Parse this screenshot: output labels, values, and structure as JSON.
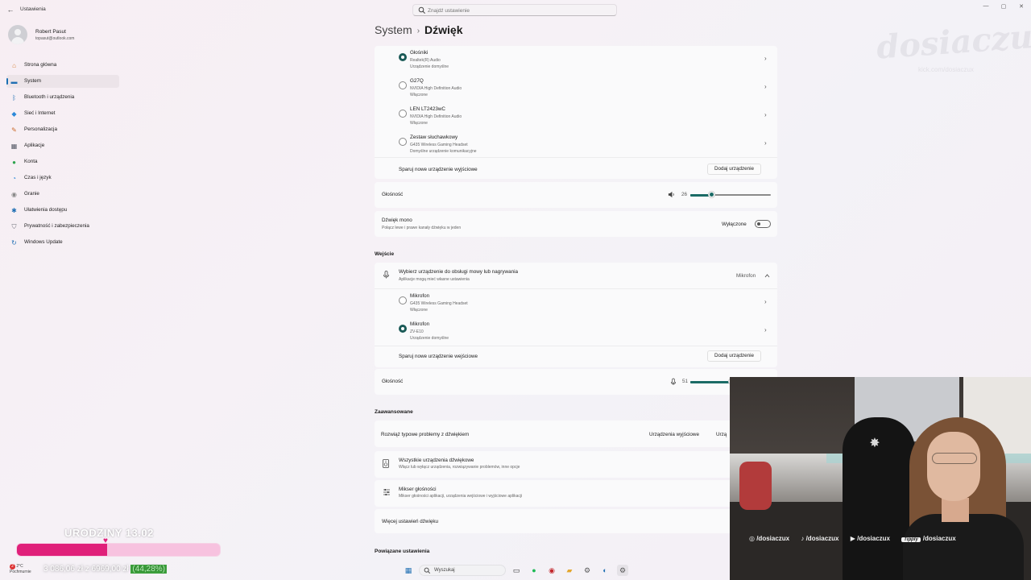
{
  "window": {
    "title": "Ustawienia",
    "back_glyph": "←",
    "controls": {
      "minimize": "—",
      "maximize": "▢",
      "close": "✕"
    }
  },
  "search": {
    "placeholder": "Znajdź ustawienie"
  },
  "profile": {
    "name": "Robert Pasut",
    "email": "topasut@outlook.com"
  },
  "nav": [
    {
      "label": "Strona główna",
      "icon": "home-icon",
      "glyph": "⌂",
      "color": "#d9823b"
    },
    {
      "label": "System",
      "icon": "display-icon",
      "glyph": "▬",
      "color": "#1f6fb3",
      "active": true
    },
    {
      "label": "Bluetooth i urządzenia",
      "icon": "bluetooth-icon",
      "glyph": "ᛒ",
      "color": "#1f6fb3"
    },
    {
      "label": "Sieć i Internet",
      "icon": "wifi-icon",
      "glyph": "◆",
      "color": "#2b88d8"
    },
    {
      "label": "Personalizacja",
      "icon": "brush-icon",
      "glyph": "✎",
      "color": "#cc6a2a"
    },
    {
      "label": "Aplikacje",
      "icon": "apps-icon",
      "glyph": "▦",
      "color": "#555a66"
    },
    {
      "label": "Konta",
      "icon": "person-icon",
      "glyph": "●",
      "color": "#2ea34e"
    },
    {
      "label": "Czas i język",
      "icon": "globe-clock-icon",
      "glyph": "◔",
      "color": "#2b88d8"
    },
    {
      "label": "Granie",
      "icon": "gamepad-icon",
      "glyph": "◉",
      "color": "#888"
    },
    {
      "label": "Ułatwienia dostępu",
      "icon": "accessibility-icon",
      "glyph": "✱",
      "color": "#1f6fb3"
    },
    {
      "label": "Prywatność i zabezpieczenia",
      "icon": "shield-icon",
      "glyph": "⛉",
      "color": "#6c6f78"
    },
    {
      "label": "Windows Update",
      "icon": "update-icon",
      "glyph": "↻",
      "color": "#1f6fb3"
    }
  ],
  "breadcrumb": {
    "parent": "System",
    "separator": "›",
    "current": "Dźwięk"
  },
  "output_devices": [
    {
      "name": "Głośniki",
      "driver": "Realtek(R) Audio",
      "status": "Urządzenie domyślne",
      "selected": true
    },
    {
      "name": "G27Q",
      "driver": "NVIDIA High Definition Audio",
      "status": "Włączone",
      "selected": false
    },
    {
      "name": "LEN LT2423wC",
      "driver": "NVIDIA High Definition Audio",
      "status": "Włączone",
      "selected": false
    },
    {
      "name": "Zestaw słuchawkowy",
      "driver": "G435 Wireless Gaming Headset",
      "status": "Domyślne urządzenie komunikacyjne",
      "selected": false
    }
  ],
  "output_pair": {
    "label": "Sparuj nowe urządzenie wyjściowe",
    "button": "Dodaj urządzenie"
  },
  "output_volume": {
    "label": "Głośność",
    "value": "26",
    "level": 0.26
  },
  "mono": {
    "title": "Dźwięk mono",
    "subtitle": "Połącz lewe i prawe kanały dźwięku w jeden",
    "state": "Wyłączone"
  },
  "input": {
    "heading": "Wejście",
    "choose_title": "Wybierz urządzenie do obsługi mowy lub nagrywania",
    "choose_sub": "Aplikacje mogą mieć własne ustawienia",
    "selected_label": "Mikrofon",
    "devices": [
      {
        "name": "Mikrofon",
        "driver": "G435 Wireless Gaming Headset",
        "status": "Włączone",
        "selected": false
      },
      {
        "name": "Mikrofon",
        "driver": "ZV-E10",
        "status": "Urządzenie domyślne",
        "selected": true
      }
    ],
    "pair_label": "Sparuj nowe urządzenie wejściowe",
    "pair_button": "Dodaj urządzenie",
    "volume_label": "Głośność",
    "volume_value": "51",
    "volume_level": 0.51
  },
  "advanced": {
    "heading": "Zaawansowane",
    "troubleshoot": "Rozwiąż typowe problemy z dźwiękiem",
    "troubleshoot_btn1": "Urządzenia wyjściowe",
    "troubleshoot_btn2": "Urzą",
    "all_devices_title": "Wszystkie urządzenia dźwiękowe",
    "all_devices_sub": "Włącz lub wyłącz urządzenia, rozwiązywanie problemów, inne opcje",
    "mixer_title": "Mikser głośności",
    "mixer_sub": "Mikser głośności aplikacji, urządzenia wejściowe i wyjściowe aplikacji",
    "more": "Więcej ustawień dźwięku"
  },
  "related": {
    "heading": "Powiązane ustawienia"
  },
  "watermark": {
    "main": "dosiaczux",
    "sub": "kick.com/dosiaczux"
  },
  "stream": {
    "goal_title": "URODZINY 13.02",
    "goal_amount": "3 086,06 zł z 6969,00 zł",
    "goal_percent": "(44,28%)",
    "goal_fraction": 0.4428,
    "socials": [
      "/dosiaczux",
      "/dosiaczux",
      "/dosiaczux",
      "/dosiaczux"
    ],
    "tipply": "Tipply"
  },
  "taskbar": {
    "weather_temp": "2°C",
    "weather_desc": "Pochmurnie",
    "weather_badge": "2",
    "search_label": "Wyszukaj"
  },
  "colors": {
    "accent": "#1b6b66",
    "nav_accent": "#1a6fb3",
    "goal_fill": "#e0207a"
  }
}
